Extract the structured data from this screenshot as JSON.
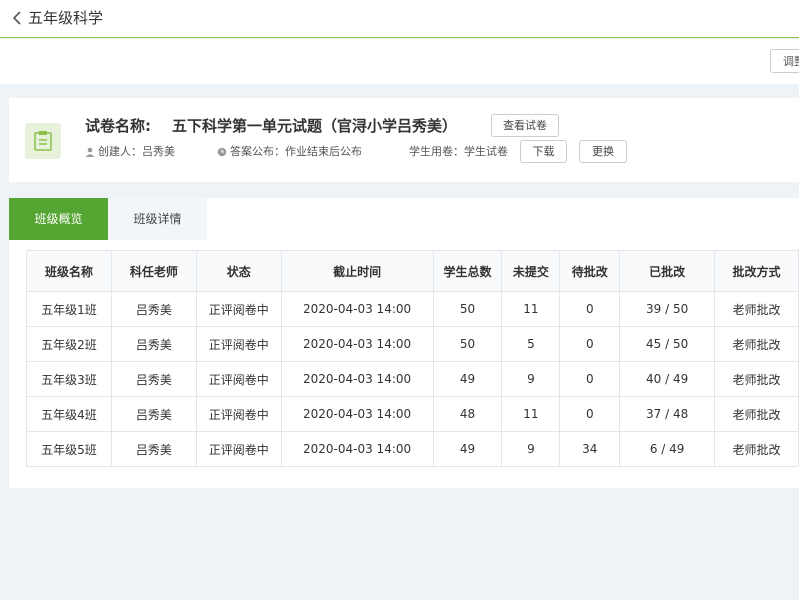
{
  "header": {
    "title": "五年级科学"
  },
  "toolbar": {
    "adjust_label": "调整"
  },
  "paper": {
    "label": "试卷名称:",
    "name": "五下科学第一单元试题（官浔小学吕秀美）",
    "view_button": "查看试卷",
    "creator": "创建人：吕秀美",
    "answer_release": "答案公布：作业结束后公布",
    "student_paper": "学生用卷：学生试卷",
    "download_button": "下载",
    "replace_button": "更换"
  },
  "tabs": [
    {
      "label": "班级概览"
    },
    {
      "label": "班级详情"
    }
  ],
  "table": {
    "headers": [
      "班级名称",
      "科任老师",
      "状态",
      "截止时间",
      "学生总数",
      "未提交",
      "待批改",
      "已批改",
      "批改方式"
    ],
    "rows": [
      [
        "五年级1班",
        "吕秀美",
        "正评阅卷中",
        "2020-04-03 14:00",
        "50",
        "11",
        "0",
        "39 / 50",
        "老师批改"
      ],
      [
        "五年级2班",
        "吕秀美",
        "正评阅卷中",
        "2020-04-03 14:00",
        "50",
        "5",
        "0",
        "45 / 50",
        "老师批改"
      ],
      [
        "五年级3班",
        "吕秀美",
        "正评阅卷中",
        "2020-04-03 14:00",
        "49",
        "9",
        "0",
        "40 / 49",
        "老师批改"
      ],
      [
        "五年级4班",
        "吕秀美",
        "正评阅卷中",
        "2020-04-03 14:00",
        "48",
        "11",
        "0",
        "37 / 48",
        "老师批改"
      ],
      [
        "五年级5班",
        "吕秀美",
        "正评阅卷中",
        "2020-04-03 14:00",
        "49",
        "9",
        "34",
        "6 / 49",
        "老师批改"
      ]
    ]
  },
  "colors": {
    "accent": "#55a532",
    "background": "#eef3f8"
  }
}
